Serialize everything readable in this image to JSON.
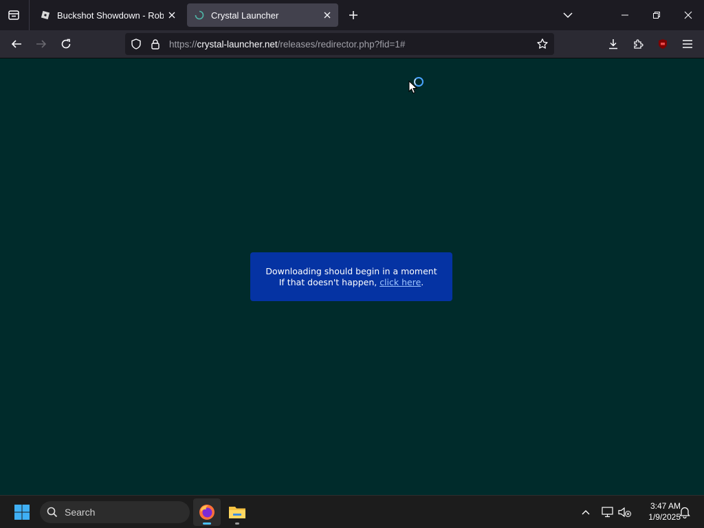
{
  "browser": {
    "tabs": [
      {
        "title": "Buckshot Showdown - Roblox",
        "active": false
      },
      {
        "title": "Crystal Launcher",
        "active": true
      }
    ],
    "url": {
      "scheme": "https://",
      "host": "crystal-launcher.net",
      "path": "/releases/redirector.php?fid=1#"
    }
  },
  "page": {
    "notice_line1": "Downloading should begin in a moment",
    "notice_line2_prefix": "If that doesn't happen, ",
    "notice_link": "click here",
    "notice_line2_suffix": "."
  },
  "taskbar": {
    "search_label": "Search",
    "time": "3:47 AM",
    "date": "1/9/2025"
  },
  "colors": {
    "page_background": "#002b2b",
    "notice_background": "#0533a3",
    "browser_chrome": "#1c1b22"
  }
}
